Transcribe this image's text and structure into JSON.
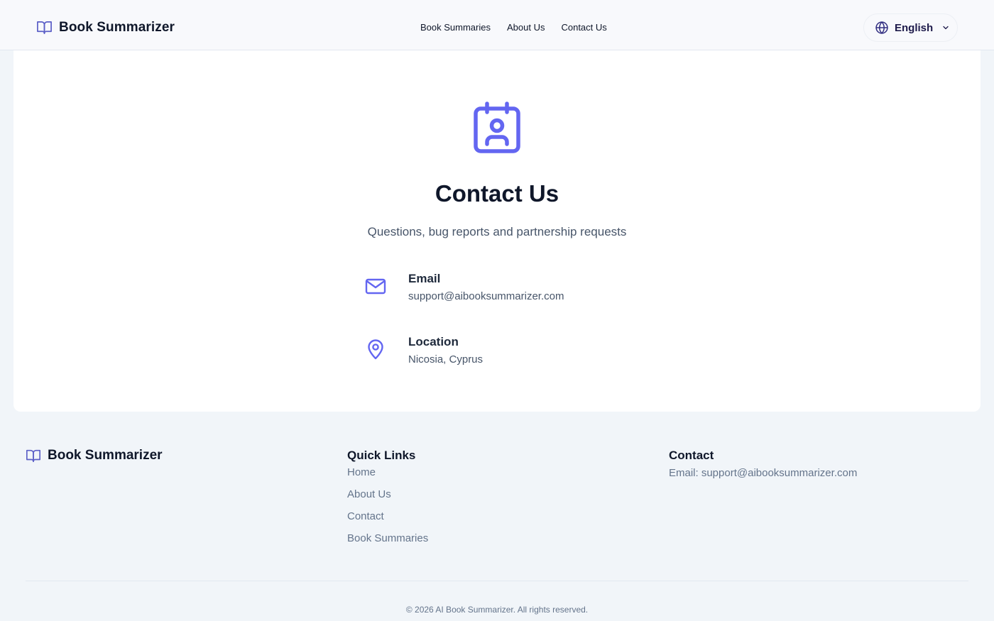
{
  "header": {
    "brand": "Book Summarizer",
    "nav": [
      "Book Summaries",
      "About Us",
      "Contact Us"
    ],
    "language": "English"
  },
  "main": {
    "title": "Contact Us",
    "subtitle": "Questions, bug reports and partnership requests",
    "email": {
      "label": "Email",
      "value": "support@aibooksummarizer.com"
    },
    "location": {
      "label": "Location",
      "value": "Nicosia, Cyprus"
    }
  },
  "footer": {
    "brand": "Book Summarizer",
    "quick_links_title": "Quick Links",
    "quick_links": [
      "Home",
      "About Us",
      "Contact",
      "Book Summaries"
    ],
    "contact_title": "Contact",
    "contact_email": "Email: support@aibooksummarizer.com",
    "copyright": "© 2026 AI Book Summarizer. All rights reserved."
  },
  "icons": {
    "brand": "open-book-icon",
    "language": "globe-icon",
    "dropdown": "chevron-down-icon",
    "hero": "contact-card-icon",
    "email": "mail-icon",
    "location": "map-pin-icon"
  },
  "colors": {
    "accent": "#6366f1",
    "accent_secondary": "#5b5fc7"
  }
}
